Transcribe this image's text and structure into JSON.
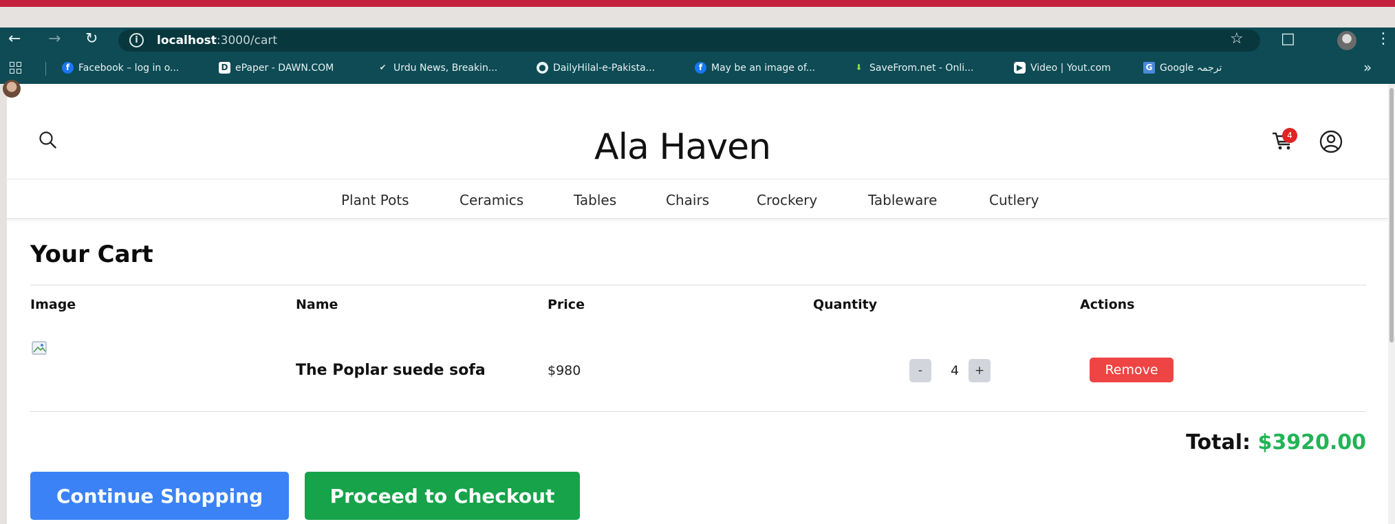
{
  "browser": {
    "url_host": "localhost",
    "url_path": ":3000/cart",
    "bookmarks": [
      {
        "label": "Facebook – log in o...",
        "icon": "facebook-icon"
      },
      {
        "label": "ePaper - DAWN.COM",
        "icon": "dawn-icon"
      },
      {
        "label": "Urdu News, Breakin...",
        "icon": "urdu-news-icon"
      },
      {
        "label": "DailyHilal-e-Pakista...",
        "icon": "globe-icon"
      },
      {
        "label": "May be an image of...",
        "icon": "facebook-icon"
      },
      {
        "label": "SaveFrom.net - Onli...",
        "icon": "savefrom-icon"
      },
      {
        "label": "Video | Yout.com",
        "icon": "yout-icon"
      },
      {
        "label": "Google ترجمہ",
        "icon": "google-translate-icon"
      }
    ],
    "more_label": "»"
  },
  "site": {
    "brand": "Ala Haven",
    "cart_count": "4",
    "categories": [
      "Plant Pots",
      "Ceramics",
      "Tables",
      "Chairs",
      "Crockery",
      "Tableware",
      "Cutlery"
    ]
  },
  "cart": {
    "title": "Your Cart",
    "headers": {
      "image": "Image",
      "name": "Name",
      "price": "Price",
      "quantity": "Quantity",
      "actions": "Actions"
    },
    "items": [
      {
        "name": "The Poplar suede sofa",
        "price": "$980",
        "quantity": "4",
        "decrement": "-",
        "increment": "+",
        "remove_label": "Remove"
      }
    ],
    "total_label": "Total:",
    "total_value": "$3920.00",
    "continue_label": "Continue Shopping",
    "checkout_label": "Proceed to Checkout"
  },
  "colors": {
    "chrome": "#0e4b54",
    "slide_accent": "#c4213f",
    "remove": "#ef4444",
    "continue": "#3b82f6",
    "checkout": "#16a34a",
    "total": "#22b357",
    "badge": "#e02424"
  }
}
